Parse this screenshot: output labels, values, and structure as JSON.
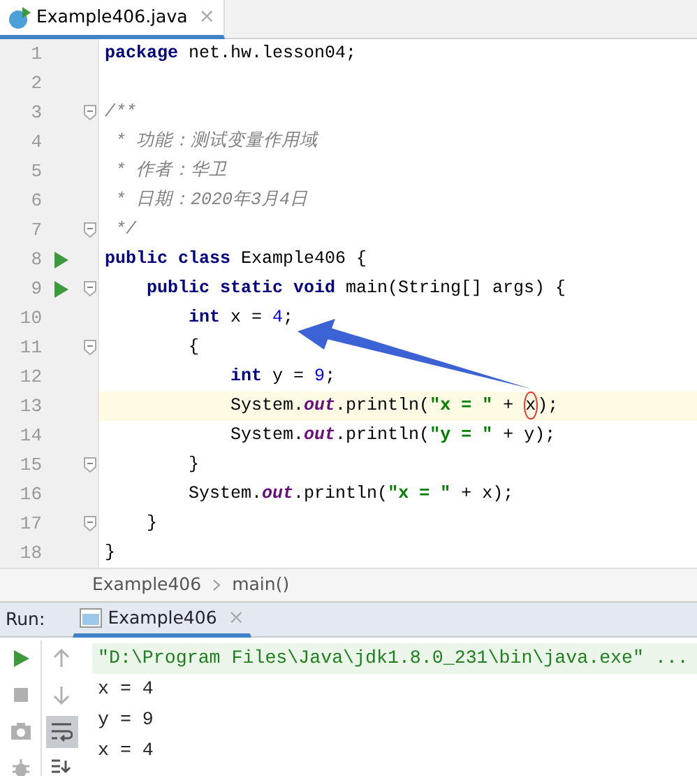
{
  "editor_tab": {
    "label": "Example406.java",
    "close": "×",
    "selected": true
  },
  "code_lines": [
    {
      "number": "1",
      "run": false,
      "fold": false,
      "highlighted": false,
      "tokens": [
        {
          "kind": "keyword",
          "text": "package"
        },
        {
          "kind": "plain",
          "text": " net.hw.lesson04;"
        }
      ]
    },
    {
      "number": "2",
      "run": false,
      "fold": false,
      "highlighted": false
    },
    {
      "number": "3",
      "run": false,
      "fold": true,
      "highlighted": false,
      "tokens": [
        {
          "kind": "comment",
          "text": "/**"
        }
      ]
    },
    {
      "number": "4",
      "run": false,
      "fold": false,
      "highlighted": false,
      "tokens": [
        {
          "kind": "comment",
          "text": " * 功能：测试变量作用域"
        }
      ]
    },
    {
      "number": "5",
      "run": false,
      "fold": false,
      "highlighted": false,
      "tokens": [
        {
          "kind": "comment",
          "text": " * 作者：华卫"
        }
      ]
    },
    {
      "number": "6",
      "run": false,
      "fold": false,
      "highlighted": false,
      "tokens": [
        {
          "kind": "comment",
          "text": " * 日期：2020年3月4日"
        }
      ]
    },
    {
      "number": "7",
      "run": false,
      "fold": true,
      "highlighted": false,
      "tokens": [
        {
          "kind": "comment",
          "text": " */"
        }
      ]
    },
    {
      "number": "8",
      "run": true,
      "fold": false,
      "highlighted": false,
      "tokens": [
        {
          "kind": "keyword",
          "text": "public class"
        },
        {
          "kind": "plain",
          "text": " Example406 {"
        }
      ]
    },
    {
      "number": "9",
      "run": true,
      "fold": true,
      "highlighted": false,
      "tokens": [
        {
          "kind": "keyword",
          "text": "    public static void"
        },
        {
          "kind": "plain",
          "text": " main(String[] args) {"
        }
      ]
    },
    {
      "number": "10",
      "run": false,
      "fold": false,
      "highlighted": false,
      "tokens": [
        {
          "kind": "keyword",
          "text": "        int"
        },
        {
          "kind": "plain",
          "text": " x = "
        },
        {
          "kind": "number",
          "text": "4"
        },
        {
          "kind": "plain",
          "text": ";"
        }
      ]
    },
    {
      "number": "11",
      "run": false,
      "fold": true,
      "highlighted": false,
      "tokens": [
        {
          "kind": "plain",
          "text": "        {"
        }
      ]
    },
    {
      "number": "12",
      "run": false,
      "fold": false,
      "highlighted": false,
      "tokens": [
        {
          "kind": "keyword",
          "text": "            int"
        },
        {
          "kind": "plain",
          "text": " y = "
        },
        {
          "kind": "number",
          "text": "9"
        },
        {
          "kind": "plain",
          "text": ";"
        }
      ]
    },
    {
      "number": "13",
      "run": false,
      "fold": false,
      "highlighted": true,
      "tokens": [
        {
          "kind": "plain",
          "text": "            System."
        },
        {
          "kind": "field",
          "text": "out"
        },
        {
          "kind": "plain",
          "text": ".println("
        },
        {
          "kind": "string",
          "text": "\"x = \""
        },
        {
          "kind": "plain",
          "text": " + "
        },
        {
          "kind": "circled",
          "text": "x"
        },
        {
          "kind": "plain",
          "text": ");"
        }
      ]
    },
    {
      "number": "14",
      "run": false,
      "fold": false,
      "highlighted": false,
      "tokens": [
        {
          "kind": "plain",
          "text": "            System."
        },
        {
          "kind": "field",
          "text": "out"
        },
        {
          "kind": "plain",
          "text": ".println("
        },
        {
          "kind": "string",
          "text": "\"y = \""
        },
        {
          "kind": "plain",
          "text": " + y);"
        }
      ]
    },
    {
      "number": "15",
      "run": false,
      "fold": true,
      "highlighted": false,
      "tokens": [
        {
          "kind": "plain",
          "text": "        }"
        }
      ]
    },
    {
      "number": "16",
      "run": false,
      "fold": false,
      "highlighted": false,
      "tokens": [
        {
          "kind": "plain",
          "text": "        System."
        },
        {
          "kind": "field",
          "text": "out"
        },
        {
          "kind": "plain",
          "text": ".println("
        },
        {
          "kind": "string",
          "text": "\"x = \""
        },
        {
          "kind": "plain",
          "text": " + x);"
        }
      ]
    },
    {
      "number": "17",
      "run": false,
      "fold": true,
      "highlighted": false,
      "tokens": [
        {
          "kind": "plain",
          "text": "    }"
        }
      ]
    },
    {
      "number": "18",
      "run": false,
      "fold": false,
      "highlighted": false,
      "tokens": [
        {
          "kind": "plain",
          "text": "}"
        }
      ]
    }
  ],
  "breadcrumb": [
    "Example406",
    "main()"
  ],
  "run_panel": {
    "label": "Run:",
    "tab": {
      "label": "Example406",
      "close": "×",
      "selected": true
    }
  },
  "run_toolbar": [
    {
      "kind": "run",
      "on": false
    },
    {
      "kind": "up",
      "on": false
    },
    {
      "kind": "stop",
      "on": false
    },
    {
      "kind": "down",
      "on": false
    },
    {
      "kind": "camera",
      "on": false
    },
    {
      "kind": "wrap",
      "on": true
    },
    {
      "kind": "bug",
      "on": false
    },
    {
      "kind": "scroll-end",
      "on": false
    }
  ],
  "console_lines": [
    {
      "kind": "command",
      "text": "\"D:\\Program Files\\Java\\jdk1.8.0_231\\bin\\java.exe\" ..."
    },
    {
      "kind": "output",
      "text": "x = 4"
    },
    {
      "kind": "output",
      "text": "y = 9"
    },
    {
      "kind": "output",
      "text": "x = 4"
    }
  ]
}
